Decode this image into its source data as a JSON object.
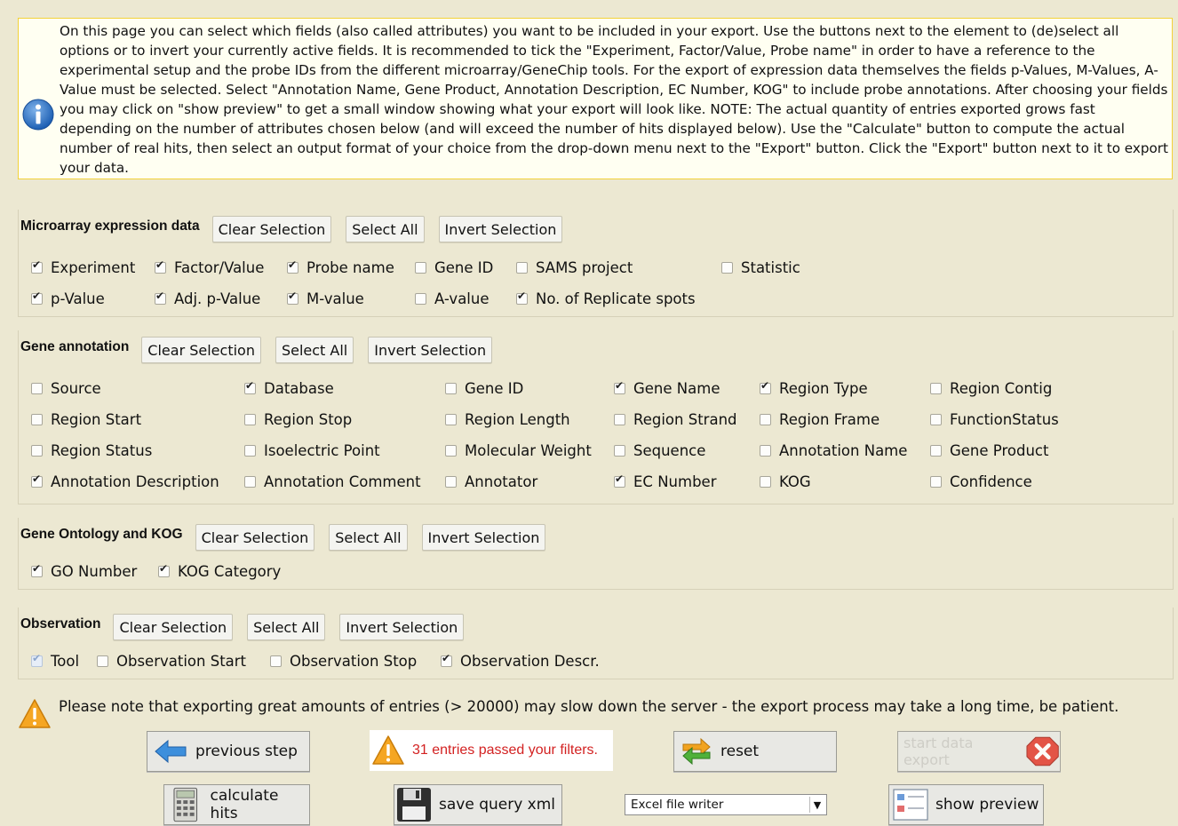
{
  "info_text": "On this page you can select which fields (also called attributes) you want to be included in your export. Use the buttons next to the element to (de)select all options or to invert your currently active fields. It is recommended to tick the \"Experiment, Factor/Value, Probe name\" in order to have a reference to the experimental setup and the probe IDs from the different microarray/GeneChip tools. For the export of expression data themselves the fields p-Values, M-Values, A-Value must be selected. Select \"Annotation Name, Gene Product, Annotation Description, EC Number, KOG\" to include probe annotations. After choosing your fields you may click on \"show preview\" to get a small window showing what your export will look like. NOTE: The actual quantity of entries exported grows fast depending on the number of attributes chosen below (and will exceed the number of hits displayed below). Use the \"Calculate\" button to compute the actual number of real hits, then select an output format of your choice from the drop-down menu next to the \"Export\" button. Click the \"Export\" button next to it to export your data.",
  "section_buttons": {
    "clear": "Clear Selection",
    "select_all": "Select All",
    "invert": "Invert Selection"
  },
  "sections": {
    "microarray": {
      "title": "Microarray expression data",
      "fields": [
        {
          "label": "Experiment",
          "checked": true
        },
        {
          "label": "Factor/Value",
          "checked": true
        },
        {
          "label": "Probe name",
          "checked": true
        },
        {
          "label": "Gene ID",
          "checked": false
        },
        {
          "label": "SAMS project",
          "checked": false
        },
        {
          "label": "Statistic",
          "checked": false
        },
        {
          "label": "p-Value",
          "checked": true
        },
        {
          "label": "Adj. p-Value",
          "checked": true
        },
        {
          "label": "M-value",
          "checked": true
        },
        {
          "label": "A-value",
          "checked": false
        },
        {
          "label": "No. of Replicate spots",
          "checked": true
        }
      ]
    },
    "gene_annotation": {
      "title": "Gene annotation",
      "fields": [
        {
          "label": "Source",
          "checked": false
        },
        {
          "label": "Database",
          "checked": true
        },
        {
          "label": "Gene ID",
          "checked": false
        },
        {
          "label": "Gene Name",
          "checked": true
        },
        {
          "label": "Region Type",
          "checked": true
        },
        {
          "label": "Region Contig",
          "checked": false
        },
        {
          "label": "Region Start",
          "checked": false
        },
        {
          "label": "Region Stop",
          "checked": false
        },
        {
          "label": "Region Length",
          "checked": false
        },
        {
          "label": "Region Strand",
          "checked": false
        },
        {
          "label": "Region Frame",
          "checked": false
        },
        {
          "label": "FunctionStatus",
          "checked": false
        },
        {
          "label": "Region Status",
          "checked": false
        },
        {
          "label": "Isoelectric Point",
          "checked": false
        },
        {
          "label": "Molecular Weight",
          "checked": false
        },
        {
          "label": "Sequence",
          "checked": false
        },
        {
          "label": "Annotation Name",
          "checked": false
        },
        {
          "label": "Gene Product",
          "checked": false
        },
        {
          "label": "Annotation Description",
          "checked": true
        },
        {
          "label": "Annotation Comment",
          "checked": false
        },
        {
          "label": "Annotator",
          "checked": false
        },
        {
          "label": "EC Number",
          "checked": true
        },
        {
          "label": "KOG",
          "checked": false
        },
        {
          "label": "Confidence",
          "checked": false
        }
      ]
    },
    "go_kog": {
      "title": "Gene Ontology and KOG",
      "fields": [
        {
          "label": "GO Number",
          "checked": true
        },
        {
          "label": "KOG Category",
          "checked": true
        }
      ]
    },
    "observation": {
      "title": "Observation",
      "fields": [
        {
          "label": "Tool",
          "checked": true,
          "disabled": true
        },
        {
          "label": "Observation Start",
          "checked": false
        },
        {
          "label": "Observation Stop",
          "checked": false
        },
        {
          "label": "Observation Descr.",
          "checked": true
        }
      ]
    }
  },
  "warning_text": "Please note that exporting great amounts of entries (> 20000) may slow down the server - the export process may take a long time, be patient.",
  "actions": {
    "previous_step": "previous step",
    "status_message": "31 entries passed your filters.",
    "reset": "reset",
    "start_export": "start data export",
    "calculate_hits": "calculate hits",
    "save_query": "save query xml",
    "output_format": "Excel file writer",
    "show_preview": "show preview"
  },
  "colors": {
    "background": "#ece8d2",
    "info_border": "#f2d23a",
    "status_text": "#d32222"
  }
}
